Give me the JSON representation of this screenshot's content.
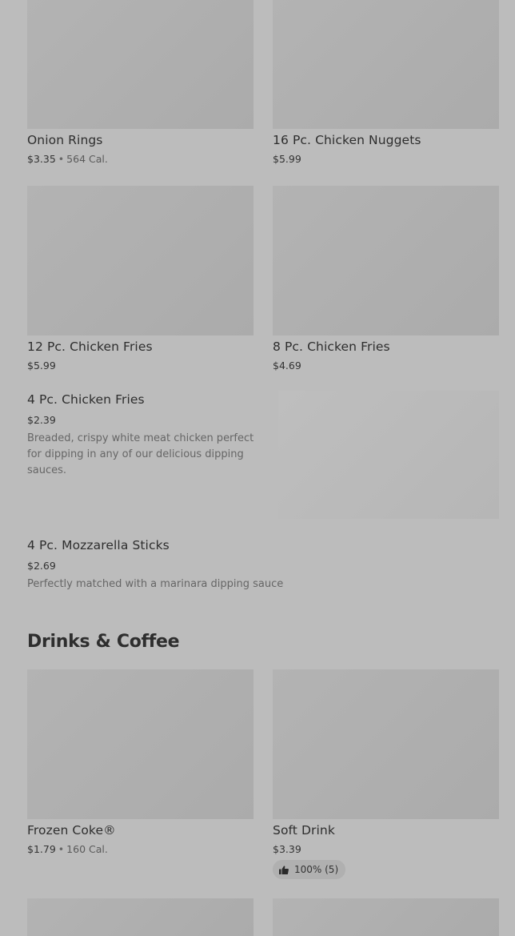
{
  "items": [
    {
      "name": "Onion Rings",
      "price": "$3.35",
      "calories": "564 Cal."
    },
    {
      "name": "16 Pc. Chicken Nuggets",
      "price": "$5.99"
    },
    {
      "name": "12 Pc. Chicken Fries",
      "price": "$5.99"
    },
    {
      "name": "8 Pc. Chicken Fries",
      "price": "$4.69"
    },
    {
      "name": "4 Pc. Chicken Fries",
      "price": "$2.39",
      "description": "Breaded, crispy white meat chicken perfect for dipping in any of our delicious dipping sauces."
    },
    {
      "name": "4 Pc. Mozzarella Sticks",
      "price": "$2.69",
      "description": "Perfectly matched with a marinara dipping sauce"
    }
  ],
  "sections": {
    "drinks_title": "Drinks & Coffee"
  },
  "drinks": [
    {
      "name": "Frozen Coke®",
      "price": "$1.79",
      "calories": "160 Cal."
    },
    {
      "name": "Soft Drink",
      "price": "$3.39",
      "rating": "100% (5)",
      "rating_icon": "thumbs-up-icon"
    }
  ],
  "separator": "•",
  "colors": {
    "overlay_bg": "#bcbcbc",
    "image_placeholder": "#ababab",
    "text": "#2e2e2e"
  }
}
